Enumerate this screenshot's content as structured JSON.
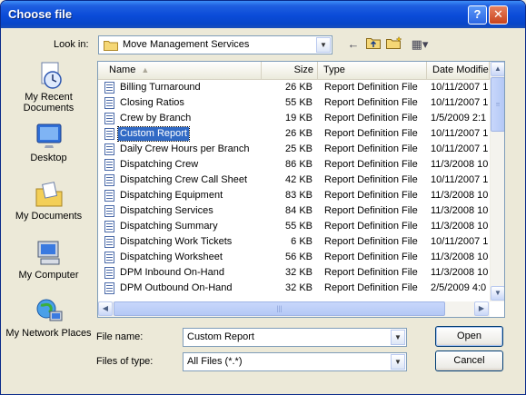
{
  "window": {
    "title": "Choose file",
    "help_glyph": "?",
    "close_glyph": "✕"
  },
  "lookin": {
    "label": "Look in:",
    "value": "Move Management Services"
  },
  "toolbar": {
    "back_glyph": "←",
    "up_glyph": "⮤",
    "newfolder_glyph": "✶",
    "views_glyph": "▦▾"
  },
  "places": [
    {
      "label": "My Recent Documents",
      "icon": "clock-doc-icon"
    },
    {
      "label": "Desktop",
      "icon": "desktop-icon"
    },
    {
      "label": "My Documents",
      "icon": "folder-doc-icon"
    },
    {
      "label": "My Computer",
      "icon": "computer-icon"
    },
    {
      "label": "My Network Places",
      "icon": "network-icon"
    }
  ],
  "columns": {
    "name": "Name",
    "size": "Size",
    "type": "Type",
    "date": "Date Modifie"
  },
  "files": [
    {
      "name": "Billing Turnaround",
      "size": "26 KB",
      "type": "Report Definition File",
      "date": "10/11/2007 1"
    },
    {
      "name": "Closing Ratios",
      "size": "55 KB",
      "type": "Report Definition File",
      "date": "10/11/2007 1"
    },
    {
      "name": "Crew by Branch",
      "size": "19 KB",
      "type": "Report Definition File",
      "date": "1/5/2009 2:1"
    },
    {
      "name": "Custom Report",
      "size": "26 KB",
      "type": "Report Definition File",
      "date": "10/11/2007 1"
    },
    {
      "name": "Daily Crew Hours per Branch",
      "size": "25 KB",
      "type": "Report Definition File",
      "date": "10/11/2007 1"
    },
    {
      "name": "Dispatching Crew",
      "size": "86 KB",
      "type": "Report Definition File",
      "date": "11/3/2008 10"
    },
    {
      "name": "Dispatching Crew Call Sheet",
      "size": "42 KB",
      "type": "Report Definition File",
      "date": "10/11/2007 1"
    },
    {
      "name": "Dispatching Equipment",
      "size": "83 KB",
      "type": "Report Definition File",
      "date": "11/3/2008 10"
    },
    {
      "name": "Dispatching Services",
      "size": "84 KB",
      "type": "Report Definition File",
      "date": "11/3/2008 10"
    },
    {
      "name": "Dispatching Summary",
      "size": "55 KB",
      "type": "Report Definition File",
      "date": "11/3/2008 10"
    },
    {
      "name": "Dispatching Work Tickets",
      "size": "6 KB",
      "type": "Report Definition File",
      "date": "10/11/2007 1"
    },
    {
      "name": "Dispatching Worksheet",
      "size": "56 KB",
      "type": "Report Definition File",
      "date": "11/3/2008 10"
    },
    {
      "name": "DPM Inbound On-Hand",
      "size": "32 KB",
      "type": "Report Definition File",
      "date": "11/3/2008 10"
    },
    {
      "name": "DPM Outbound On-Hand",
      "size": "32 KB",
      "type": "Report Definition File",
      "date": "2/5/2009 4:0"
    }
  ],
  "selected_file": "Custom Report",
  "filename": {
    "label": "File name:",
    "value": "Custom Report"
  },
  "filetype": {
    "label": "Files of type:",
    "value": "All Files (*.*)"
  },
  "buttons": {
    "open": "Open",
    "cancel": "Cancel"
  }
}
